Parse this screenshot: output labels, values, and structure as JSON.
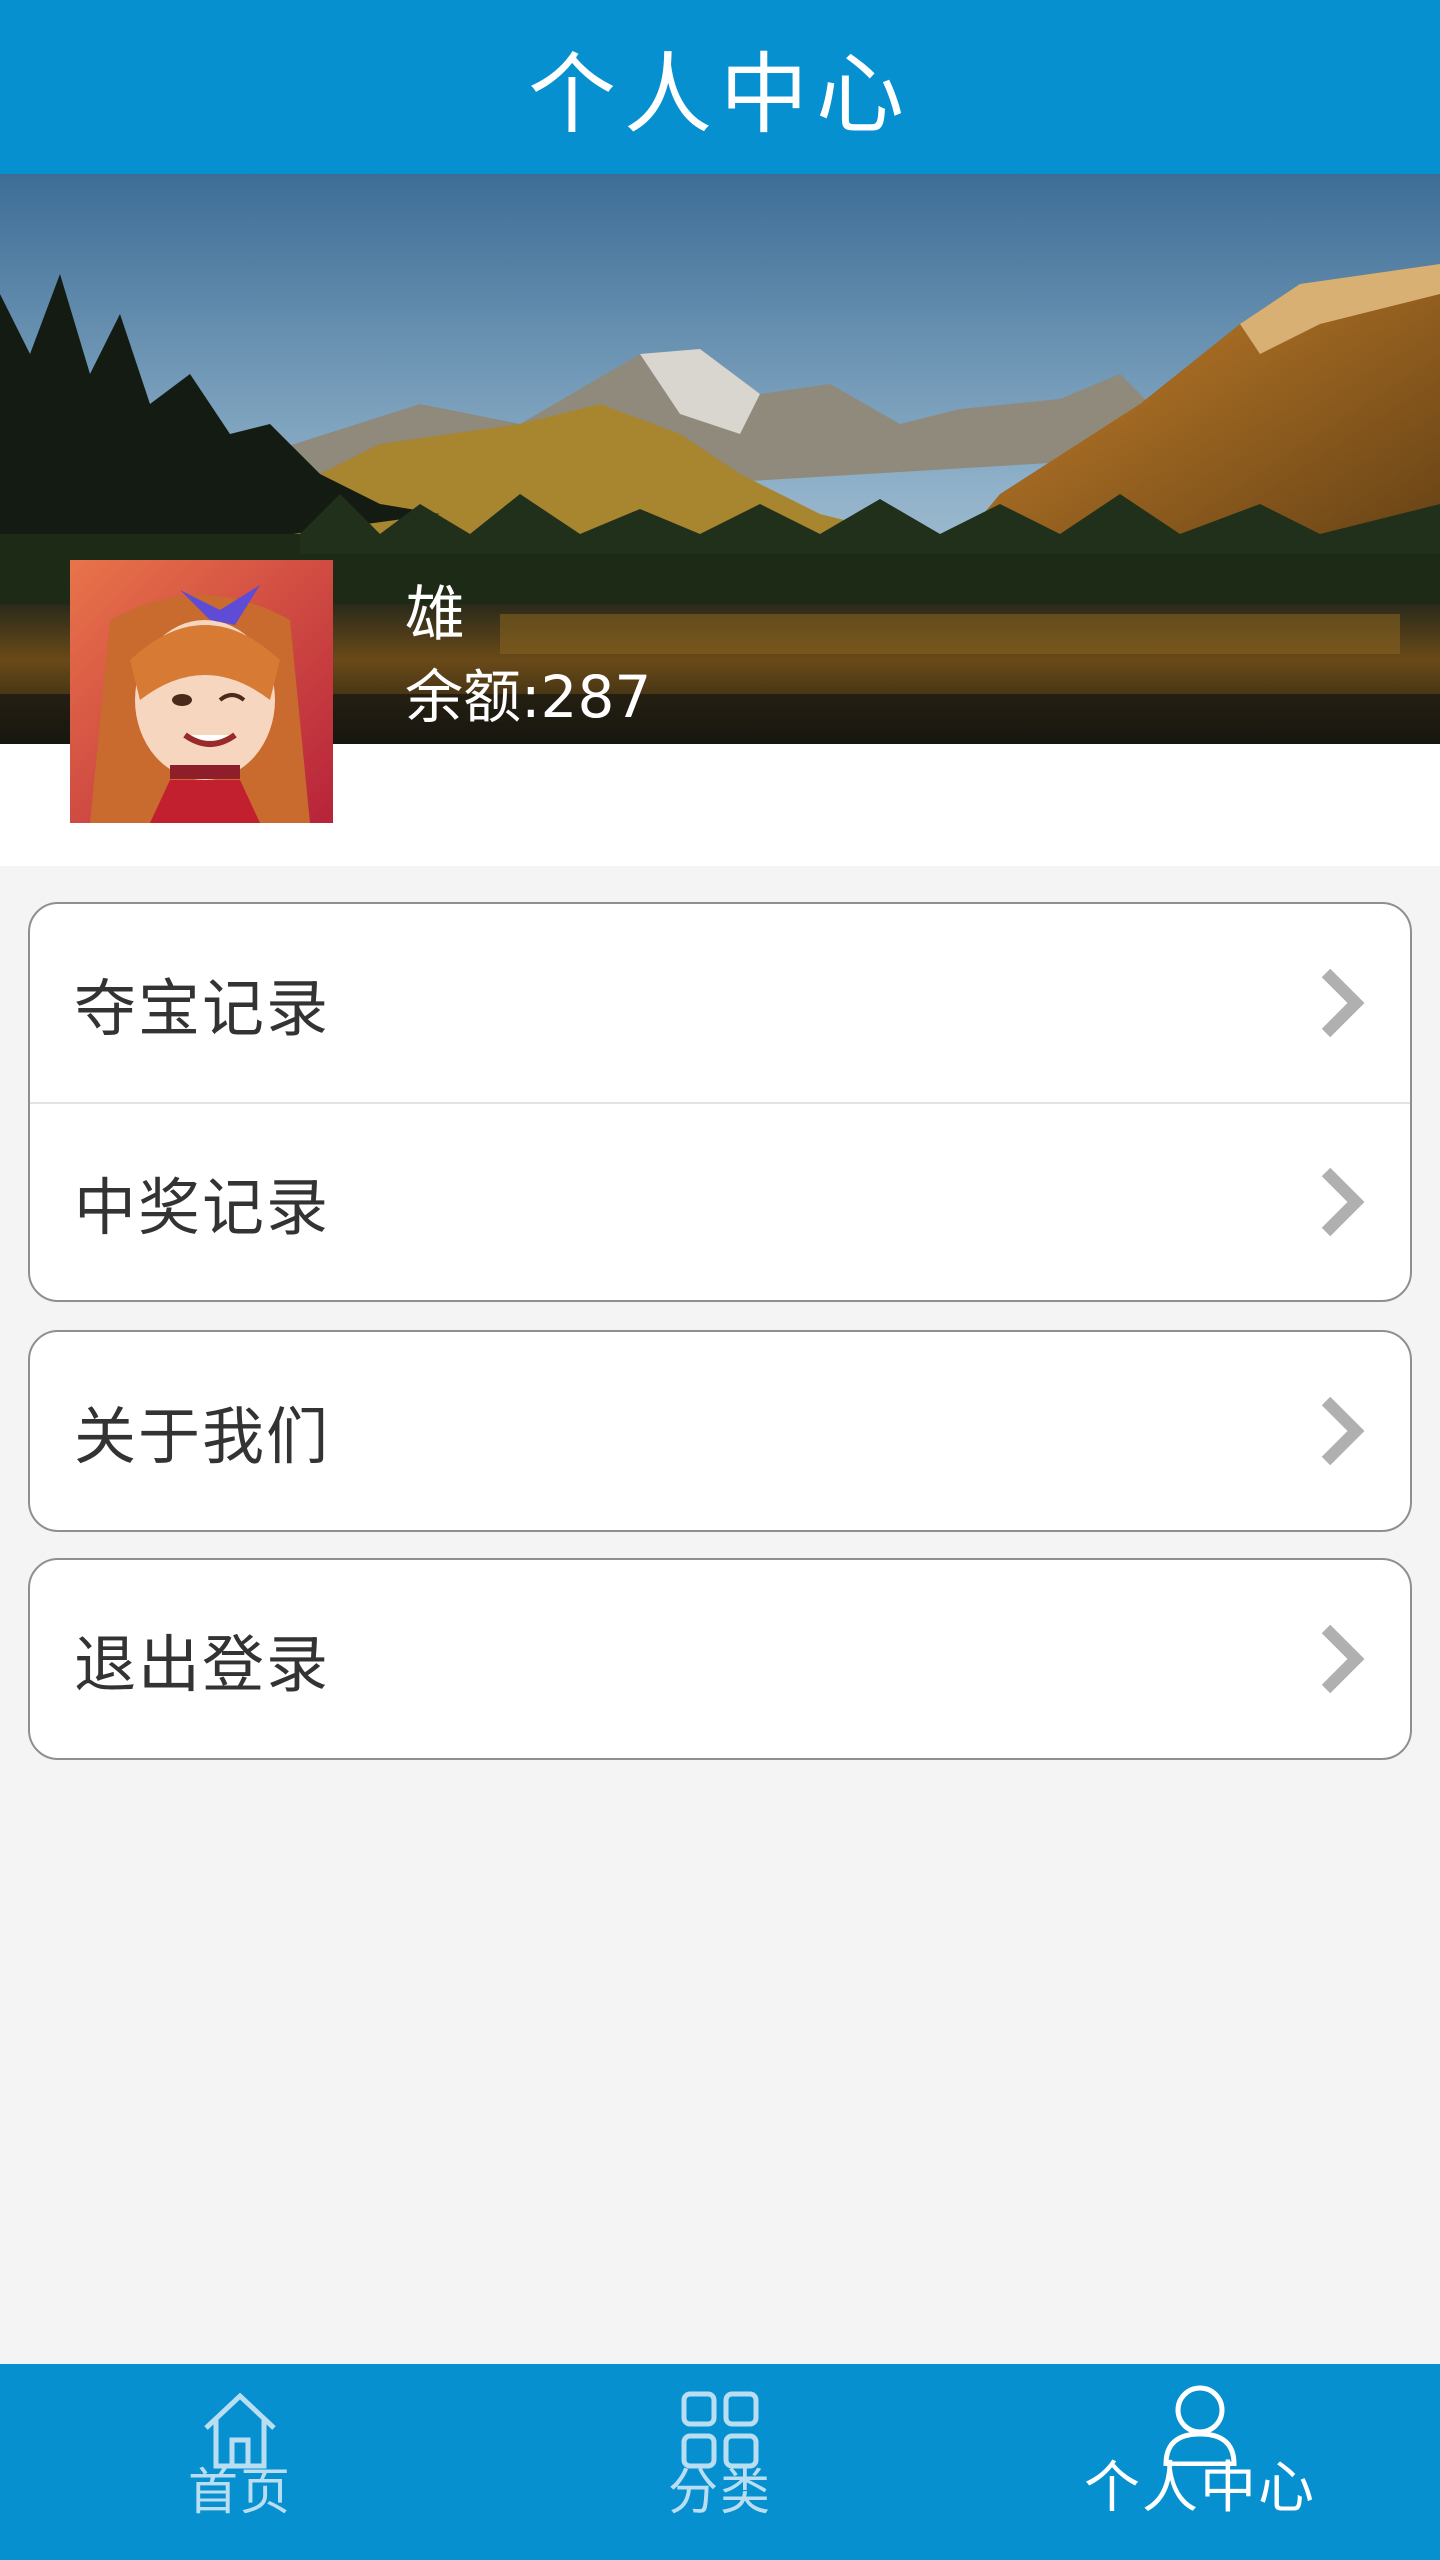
{
  "header": {
    "title": "个人中心"
  },
  "profile": {
    "name": "雄",
    "balance": "余额:287"
  },
  "menu": {
    "group1": [
      {
        "label": "夺宝记录",
        "icon": "chevron-right-icon"
      },
      {
        "label": "中奖记录",
        "icon": "chevron-right-icon"
      }
    ],
    "group2": [
      {
        "label": "关于我们",
        "icon": "chevron-right-icon"
      }
    ],
    "group3": [
      {
        "label": "退出登录",
        "icon": "chevron-right-icon"
      }
    ]
  },
  "tabbar": {
    "tabs": [
      {
        "label": "首页",
        "icon": "home-icon",
        "active": false
      },
      {
        "label": "分类",
        "icon": "grid-icon",
        "active": false
      },
      {
        "label": "个人中心",
        "icon": "user-icon",
        "active": true
      }
    ]
  },
  "colors": {
    "primary": "#0690d0",
    "background": "#f4f4f4",
    "text": "#333333",
    "chevron": "#b0b0b0"
  }
}
